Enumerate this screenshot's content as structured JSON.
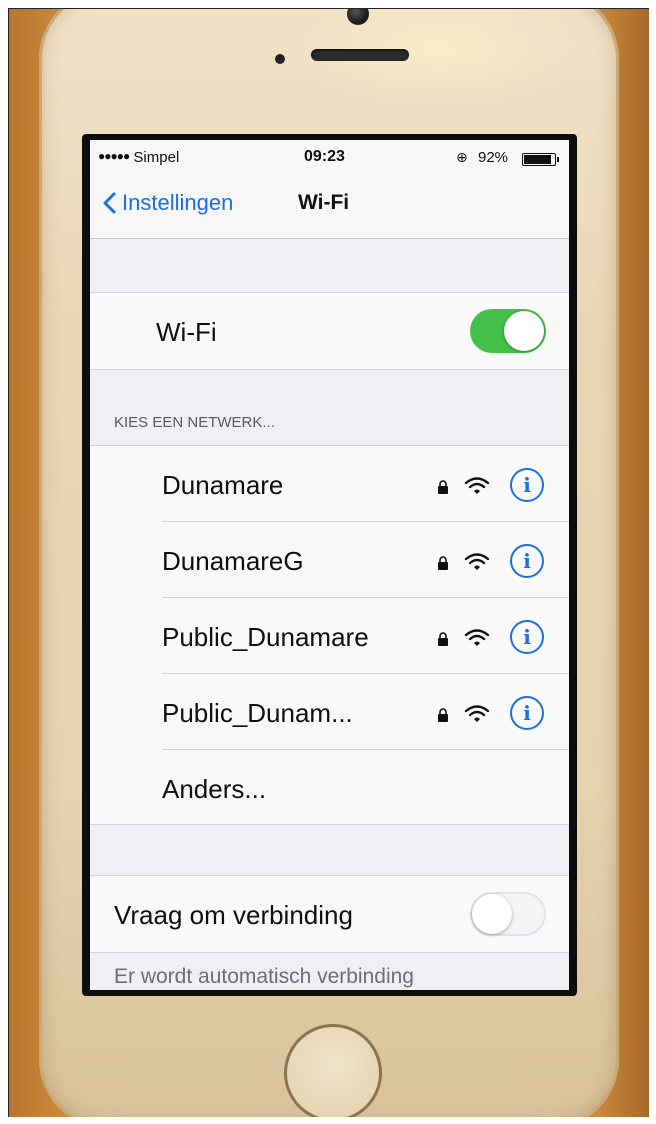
{
  "status_bar": {
    "carrier_dots": "●●●●●",
    "carrier": "Simpel",
    "time": "09:23",
    "rotation_lock_icon": "rotation-lock-icon",
    "battery_percent": "92%",
    "battery_level": 0.92
  },
  "nav": {
    "back_label": "Instellingen",
    "title": "Wi-Fi"
  },
  "wifi_toggle": {
    "label": "Wi-Fi",
    "on": true
  },
  "networks": {
    "header": "KIES EEN NETWERK...",
    "items": [
      {
        "name": "Dunamare",
        "secured": true
      },
      {
        "name": "DunamareG",
        "secured": true
      },
      {
        "name": "Public_Dunamare",
        "secured": true
      },
      {
        "name": "Public_Dunam...",
        "secured": true
      }
    ],
    "other_label": "Anders...",
    "info_glyph": "i"
  },
  "ask_to_join": {
    "label": "Vraag om verbinding",
    "on": false
  },
  "footer_text": "Er wordt automatisch verbinding",
  "colors": {
    "accent": "#1c6fe0",
    "switch_on": "#45c04a",
    "background": "#efeff4"
  }
}
